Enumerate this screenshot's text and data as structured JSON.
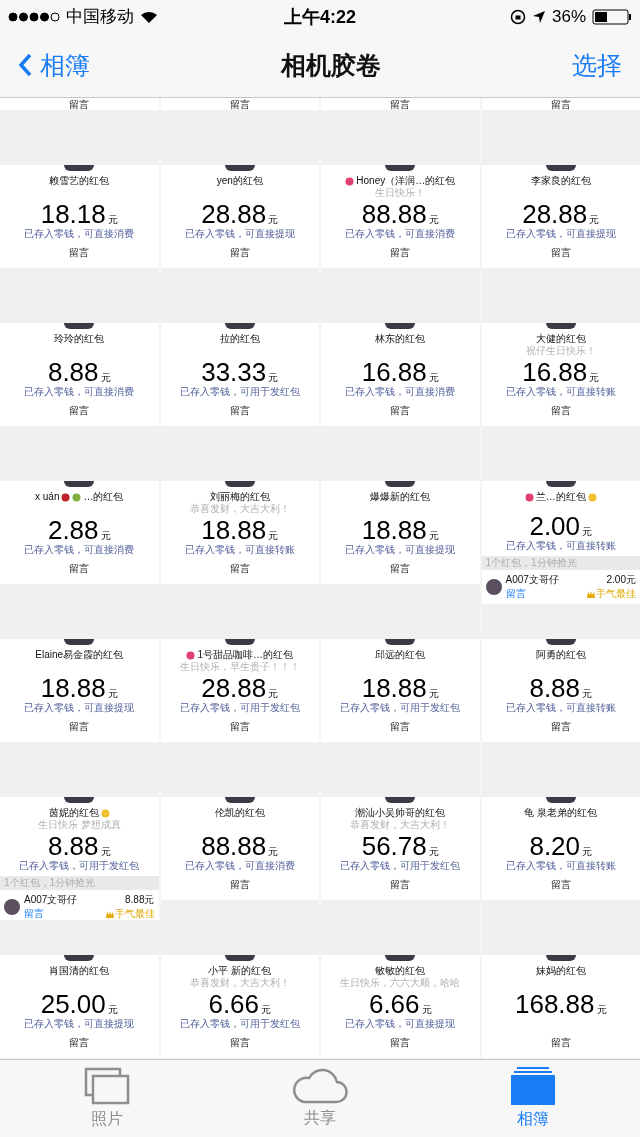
{
  "status_bar": {
    "carrier": "中国移动",
    "time": "上午4:22",
    "battery": "36%"
  },
  "nav": {
    "back": "相簿",
    "title": "相机胶卷",
    "action": "选择"
  },
  "top_partial": [
    "留言",
    "留言",
    "留言",
    "留言"
  ],
  "tiles": [
    {
      "name": "赖雪艺的红包",
      "amount": "18.18",
      "unit": "元",
      "status": "已存入零钱，可直接消费",
      "footer": {
        "kind": "comment",
        "label": "留言"
      }
    },
    {
      "name": "yen的红包",
      "amount": "28.88",
      "unit": "元",
      "status": "已存入零钱，可直接提现",
      "footer": {
        "kind": "comment",
        "label": "留言"
      }
    },
    {
      "name": "Honey（洋润…的红包",
      "emoji_before": true,
      "blessing": "生日快乐！",
      "amount": "88.88",
      "unit": "元",
      "status": "已存入零钱，可直接消费",
      "footer": {
        "kind": "comment",
        "label": "留言"
      }
    },
    {
      "name": "李家良的红包",
      "amount": "28.88",
      "unit": "元",
      "status": "已存入零钱，可直接提现",
      "footer": {
        "kind": "comment",
        "label": "留言"
      }
    },
    {
      "name": "玲玲的红包",
      "amount": "8.88",
      "unit": "元",
      "status": "已存入零钱，可直接消费",
      "footer": {
        "kind": "comment",
        "label": "留言"
      }
    },
    {
      "name": "拉的红包",
      "amount": "33.33",
      "unit": "元",
      "status": "已存入零钱，可用于发红包",
      "footer": {
        "kind": "comment",
        "label": "留言"
      }
    },
    {
      "name": "林东的红包",
      "amount": "16.88",
      "unit": "元",
      "status": "已存入零钱，可直接消费",
      "footer": {
        "kind": "comment",
        "label": "留言"
      }
    },
    {
      "name": "大健的红包",
      "blessing": "祝仔生日快乐！",
      "amount": "16.88",
      "unit": "元",
      "status": "已存入零钱，可直接转账",
      "footer": {
        "kind": "comment",
        "label": "留言"
      }
    },
    {
      "name": "x uán",
      "name_tail": "…的红包",
      "amount": "2.88",
      "unit": "元",
      "status": "已存入零钱，可直接消费",
      "footer": {
        "kind": "comment",
        "label": "留言"
      }
    },
    {
      "name": "刘丽梅的红包",
      "blessing": "恭喜发财，大吉大利！",
      "amount": "18.88",
      "unit": "元",
      "status": "已存入零钱，可直接转账",
      "footer": {
        "kind": "comment",
        "label": "留言"
      }
    },
    {
      "name": "爆爆新的红包",
      "amount": "18.88",
      "unit": "元",
      "status": "已存入零钱，可直接提现",
      "footer": {
        "kind": "comment",
        "label": "留言"
      }
    },
    {
      "name": "兰…的红包",
      "emoji_before": true,
      "emoji_after": true,
      "amount": "2.00",
      "unit": "元",
      "status": "已存入零钱，可直接转账",
      "footer": {
        "kind": "result",
        "summary": "1个红包，1分钟抢光",
        "sender": "A007文哥仔",
        "comment": "留言",
        "amount": "2.00元",
        "badge": "手气最佳"
      }
    },
    {
      "name": "Elaine易金霞的红包",
      "amount": "18.88",
      "unit": "元",
      "status": "已存入零钱，可直接提现",
      "footer": {
        "kind": "comment",
        "label": "留言"
      }
    },
    {
      "name": "1号甜品咖啡…的红包",
      "emoji_before": true,
      "blessing": "生日快乐，早生贵子！！！",
      "amount": "28.88",
      "unit": "元",
      "status": "已存入零钱，可用于发红包",
      "footer": {
        "kind": "comment",
        "label": "留言"
      }
    },
    {
      "name": "邱远的红包",
      "amount": "18.88",
      "unit": "元",
      "status": "已存入零钱，可用于发红包",
      "footer": {
        "kind": "comment",
        "label": "留言"
      }
    },
    {
      "name": "阿勇的红包",
      "amount": "8.88",
      "unit": "元",
      "status": "已存入零钱，可直接转账",
      "footer": {
        "kind": "comment",
        "label": "留言"
      }
    },
    {
      "name": "茵妮的红包",
      "emoji_after": true,
      "blessing": "生日快乐 梦想成真",
      "amount": "8.88",
      "unit": "元",
      "status": "已存入零钱，可用于发红包",
      "footer": {
        "kind": "result",
        "summary": "1个红包，1分钟抢光",
        "sender": "A007文哥仔",
        "comment": "留言",
        "amount": "8.88元",
        "badge": "手气最佳"
      }
    },
    {
      "name": "伦凯的红包",
      "amount": "88.88",
      "unit": "元",
      "status": "已存入零钱，可直接消费",
      "footer": {
        "kind": "comment",
        "label": "留言"
      }
    },
    {
      "name": "潮汕小吴帅哥的红包",
      "blessing": "恭喜发财，大吉大利！",
      "amount": "56.78",
      "unit": "元",
      "status": "已存入零钱，可用于发红包",
      "footer": {
        "kind": "comment",
        "label": "留言"
      }
    },
    {
      "name": "龟 泉老弟的红包",
      "amount": "8.20",
      "unit": "元",
      "status": "已存入零钱，可直接转账",
      "footer": {
        "kind": "comment",
        "label": "留言"
      }
    },
    {
      "name": "肖国清的红包",
      "amount": "25.00",
      "unit": "元",
      "status": "已存入零钱，可直接提现",
      "footer": {
        "kind": "comment",
        "label": "留言"
      }
    },
    {
      "name": "小平 新的红包",
      "blessing": "恭喜发财，大吉大利！",
      "amount": "6.66",
      "unit": "元",
      "status": "已存入零钱，可用于发红包",
      "footer": {
        "kind": "comment",
        "label": "留言"
      }
    },
    {
      "name": "敏敏的红包",
      "blessing": "生日快乐，六六大顺，哈哈",
      "amount": "6.66",
      "unit": "元",
      "status": "已存入零钱，可直接提现",
      "footer": {
        "kind": "comment",
        "label": "留言"
      }
    },
    {
      "name": "妹妈的红包",
      "amount": "168.88",
      "unit": "元",
      "footer": {
        "kind": "comment",
        "label": "留言"
      }
    }
  ],
  "tab_bar": [
    {
      "label": "照片",
      "selected": false
    },
    {
      "label": "共享",
      "selected": false
    },
    {
      "label": "相簿",
      "selected": true
    }
  ]
}
